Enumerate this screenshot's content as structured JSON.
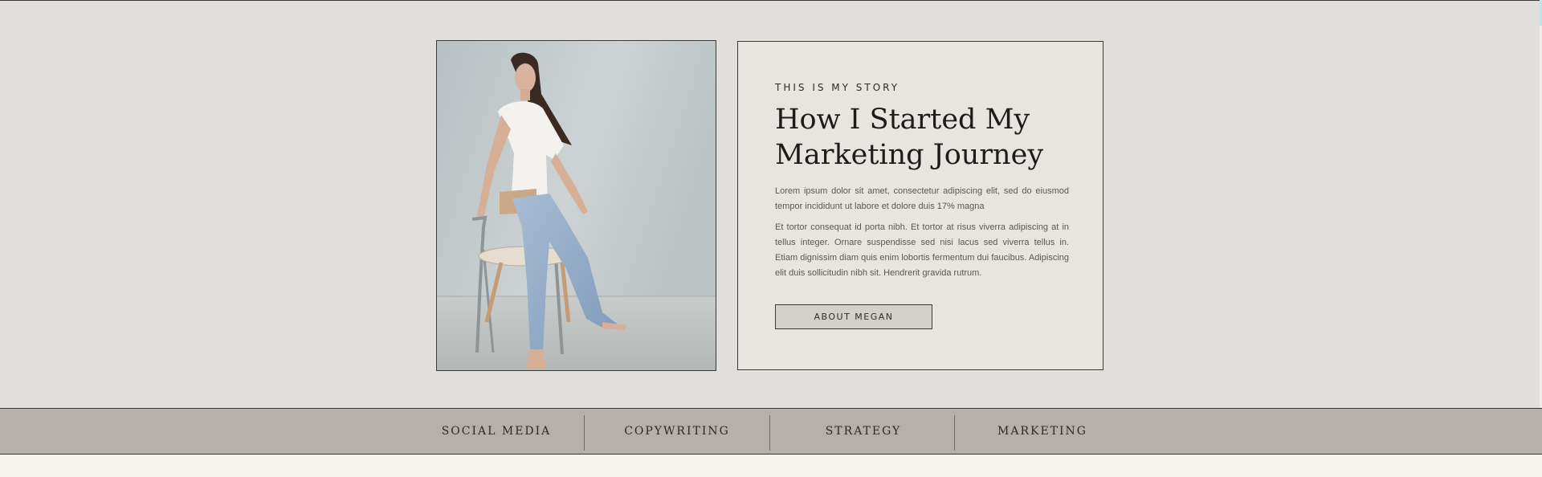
{
  "story": {
    "eyebrow": "THIS IS MY STORY",
    "title": "How I Started My Marketing Journey",
    "paragraph_1": "Lorem ipsum dolor sit amet, consectetur adipiscing elit, sed do eiusmod tempor incididunt ut labore et dolore duis 17% magna",
    "paragraph_2": "Et tortor consequat id porta nibh. Et tortor at risus viverra adipiscing at in tellus integer. Ornare suspendisse sed nisi lacus sed viverra tellus in. Etiam dignissim diam quis enim lobortis fermentum dui faucibus. Adipiscing elit duis sollicitudin nibh sit. Hendrerit gravida rutrum.",
    "button_label": "ABOUT MEGAN"
  },
  "services": [
    {
      "label": "SOCIAL MEDIA"
    },
    {
      "label": "COPYWRITING"
    },
    {
      "label": "STRATEGY"
    },
    {
      "label": "MARKETING"
    }
  ],
  "colors": {
    "page_bg": "#e0dfdb",
    "card_bg": "#e8e5e1",
    "services_bar_bg": "#b6b0ad",
    "footer_bg": "#f6f3ef",
    "border": "#3b3a38"
  }
}
